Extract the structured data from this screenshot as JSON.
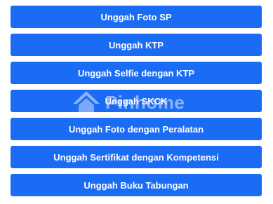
{
  "buttons": [
    {
      "label": "Unggah Foto SP"
    },
    {
      "label": "Unggah KTP"
    },
    {
      "label": "Unggah Selfie dengan KTP"
    },
    {
      "label": "Unggah SKCK"
    },
    {
      "label": "Unggah Foto dengan Peralatan"
    },
    {
      "label": "Unggah Sertifikat dengan Kompetensi"
    },
    {
      "label": "Unggah Buku Tabungan"
    }
  ],
  "watermark": {
    "text": "Pinhome",
    "icon": "house-logo-icon"
  },
  "colors": {
    "button_bg": "#1a6cf5",
    "button_text": "#ffffff",
    "background": "#ffffff"
  }
}
